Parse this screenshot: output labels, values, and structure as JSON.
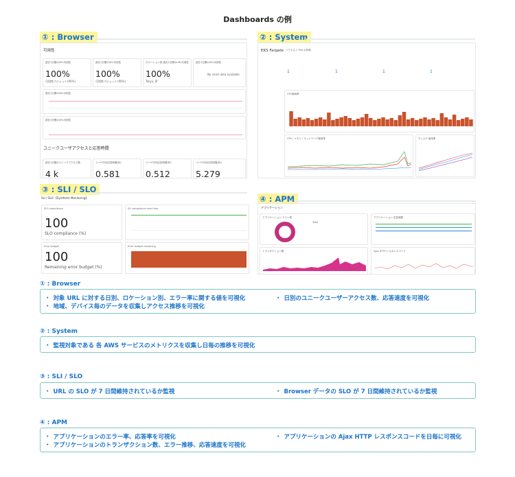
{
  "title": "Dashboards の例",
  "sections": {
    "browser": {
      "label": "① : Browser",
      "header": "可用性",
      "cards": [
        {
          "caption": "過去1日間のURL可用性",
          "value": "100%",
          "sub": "可用性パジェット(96%)"
        },
        {
          "caption": "過去1日間のURL可用性",
          "value": "100%",
          "sub": "可用性パジェット(96%)"
        },
        {
          "caption": "ロケーション別 過去1日間のURL可用性",
          "value": "100%",
          "sub": "Tokyo, JP"
        },
        {
          "caption": "過去1日間のURL可用性",
          "value": "",
          "sub": "No chart data available"
        }
      ],
      "chart1_caption": "過去1日間のURL可用性",
      "chart2_caption": "過去1日間のURL可用性",
      "subheader": "ユニークユーザアクセスと応答時間",
      "bottom_cards": [
        {
          "caption": "過去1日間のユニークアクセス数",
          "value": "4 k"
        },
        {
          "caption": "ユーザ平均応答時間(秒)",
          "value": "0.581"
        },
        {
          "caption": "ユーザ平均応答時間(秒)",
          "value": "0.512"
        },
        {
          "caption": "ユーザ平均応答時間(秒)",
          "value": "5.279"
        }
      ]
    },
    "system": {
      "label": "② : System",
      "header": "EKS Fargate",
      "metrics_caption": "リクエスト Pod の状態",
      "metrics": [
        "1",
        "1",
        "1",
        "1"
      ],
      "bar_caption": "CPU使用率",
      "chart_left_caption": "CPU / メモリ / ネットワーク使用率",
      "chart_right_caption": "ディスク 使用率"
    },
    "sli": {
      "label": "③ : SLI / SLO",
      "header": "SLI / SLO 【Synthetic Monitoring】",
      "card1_caption": "SLO compliance",
      "card1_value": "100",
      "card1_sub": "SLO compliance (%)",
      "card2_caption": "Error budget",
      "card2_value": "100",
      "card2_sub": "Remaining error budget (%)",
      "chart1_caption": "SLI compliance over time",
      "chart2_caption": "Error budget remaining"
    },
    "apm": {
      "label": "④ : APM",
      "header": "アプリケーション",
      "chart1_caption": "アプリケーション エラー率",
      "chart2_caption": "アプリケーション 応答時間",
      "pie_label": "Total",
      "chart3_caption": "トランザクション数",
      "chart4_caption": "Ajax HTTP レスポンスコード"
    }
  },
  "descriptions": [
    {
      "head": "① : Browser",
      "items_left": [
        "対象 URL に対する日別、ロケーション別、エラー率に関する値を可視化",
        "地域、デバイス毎のデータを収集しアクセス推移を可視化"
      ],
      "items_right": [
        "日別のユニークユーザーアクセス数、応答速度を可視化"
      ]
    },
    {
      "head": "② : System",
      "items_left": [
        "監視対象である 各 AWS サービスのメトリクスを収集し日毎の推移を可視化"
      ],
      "items_right": []
    },
    {
      "head": "③ : SLI / SLO",
      "items_left": [
        "URL の SLO が 7 日間維持されているか監視"
      ],
      "items_right": [
        "Browser データの SLO が 7 日間維持されているか監視"
      ]
    },
    {
      "head": "④ : APM",
      "items_left": [
        "アプリケーションのエラー率、応答率を可視化",
        "アプリケーションのトランザクション数、エラー推移、応答速度を可視化"
      ],
      "items_right": [
        "アプリケーションの Ajax HTTP レスポンスコードを日毎に可視化"
      ]
    }
  ],
  "bullet": "・",
  "colors": {
    "accent": "#1a73c9",
    "highlight": "#fff59a",
    "bar": "#c9532c",
    "pink": "#d6338c",
    "teal_border": "#7fc7c3"
  }
}
